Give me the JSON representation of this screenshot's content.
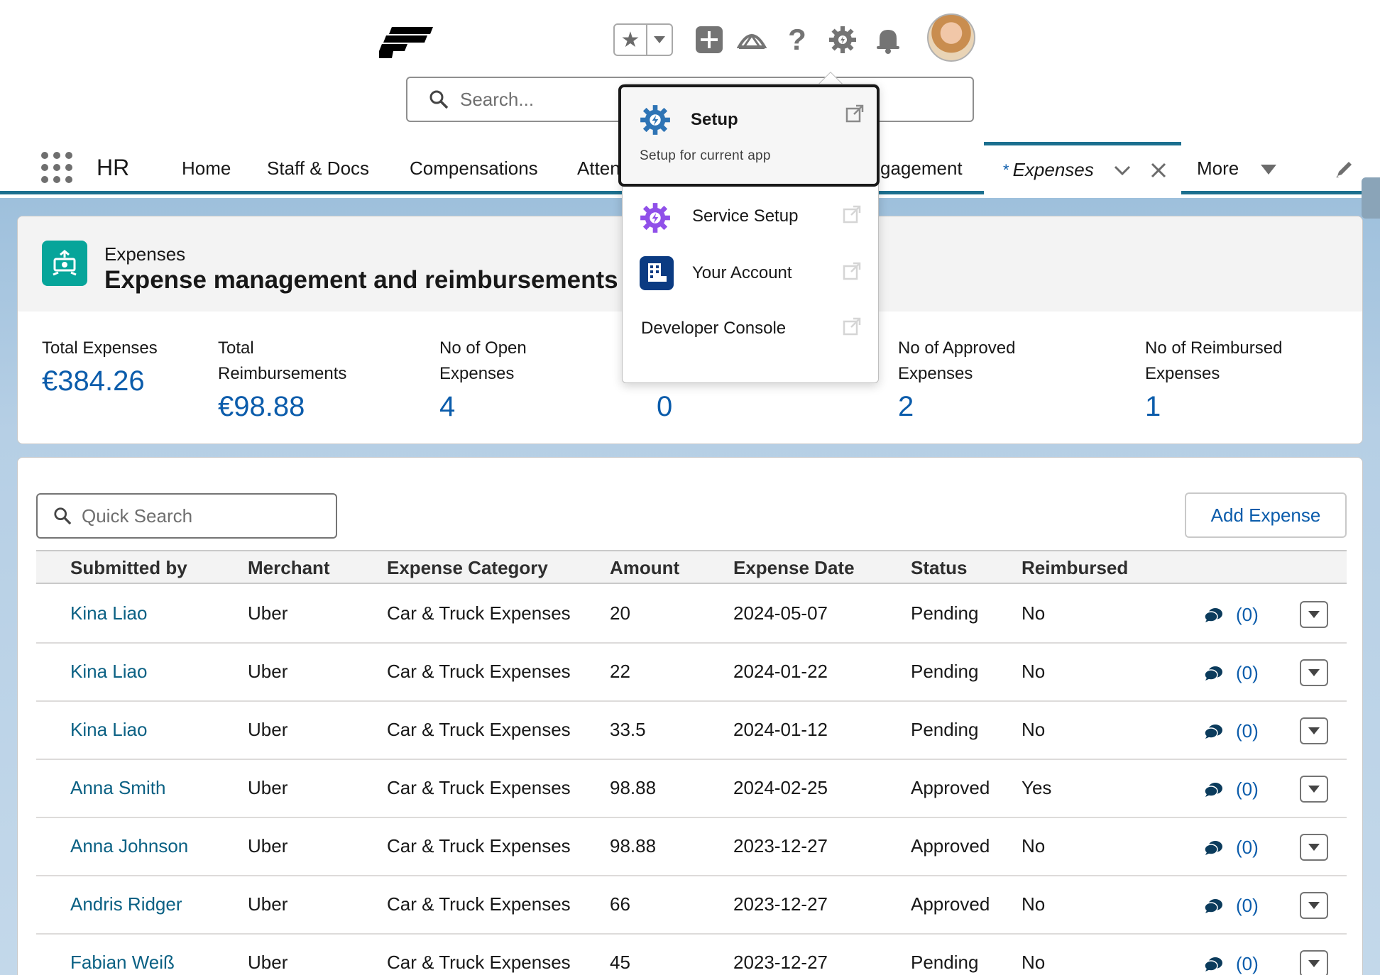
{
  "header": {
    "search_placeholder": "Search...",
    "icons": [
      "logo",
      "favorites-star-icon",
      "chevron-down-icon",
      "add-icon",
      "trailhead-icon",
      "help-icon",
      "gear-icon",
      "bell-icon",
      "avatar"
    ]
  },
  "nav": {
    "app_name": "HR",
    "items": [
      "Home",
      "Staff & Docs",
      "Compensations",
      "Atten",
      "gagement"
    ],
    "active_tab": {
      "marker": "*",
      "label": "Expenses"
    },
    "more_label": "More"
  },
  "setup_menu": {
    "setup": {
      "title": "Setup",
      "subtitle": "Setup for current app"
    },
    "service_setup": "Service Setup",
    "your_account": "Your Account",
    "developer_console": "Developer Console"
  },
  "highlights": {
    "object_label": "Expenses",
    "title": "Expense management and reimbursements",
    "metrics": [
      {
        "label": "Total Expenses",
        "value": "€384.26"
      },
      {
        "label": "Total Reimbursements",
        "value": "€98.88"
      },
      {
        "label": "No of Open Expenses",
        "value": "4"
      },
      {
        "label": "",
        "value": "0"
      },
      {
        "label": "No of Approved Expenses",
        "value": "2"
      },
      {
        "label": "No of Reimbursed Expenses",
        "value": "1"
      }
    ]
  },
  "list": {
    "quick_search_placeholder": "Quick Search",
    "add_button": "Add Expense",
    "columns": [
      "Submitted by",
      "Merchant",
      "Expense Category",
      "Amount",
      "Expense Date",
      "Status",
      "Reimbursed"
    ],
    "rows": [
      {
        "submitted_by": "Kina Liao",
        "merchant": "Uber",
        "category": "Car & Truck Expenses",
        "amount": "20",
        "date": "2024-05-07",
        "status": "Pending",
        "reimbursed": "No",
        "comments": "(0)"
      },
      {
        "submitted_by": "Kina Liao",
        "merchant": "Uber",
        "category": "Car & Truck Expenses",
        "amount": "22",
        "date": "2024-01-22",
        "status": "Pending",
        "reimbursed": "No",
        "comments": "(0)"
      },
      {
        "submitted_by": "Kina Liao",
        "merchant": "Uber",
        "category": "Car & Truck Expenses",
        "amount": "33.5",
        "date": "2024-01-12",
        "status": "Pending",
        "reimbursed": "No",
        "comments": "(0)"
      },
      {
        "submitted_by": "Anna Smith",
        "merchant": "Uber",
        "category": "Car & Truck Expenses",
        "amount": "98.88",
        "date": "2024-02-25",
        "status": "Approved",
        "reimbursed": "Yes",
        "comments": "(0)"
      },
      {
        "submitted_by": "Anna Johnson",
        "merchant": "Uber",
        "category": "Car & Truck Expenses",
        "amount": "98.88",
        "date": "2023-12-27",
        "status": "Approved",
        "reimbursed": "No",
        "comments": "(0)"
      },
      {
        "submitted_by": "Andris Ridger",
        "merchant": "Uber",
        "category": "Car & Truck Expenses",
        "amount": "66",
        "date": "2023-12-27",
        "status": "Approved",
        "reimbursed": "No",
        "comments": "(0)"
      },
      {
        "submitted_by": "Fabian Weiß",
        "merchant": "Uber",
        "category": "Car & Truck Expenses",
        "amount": "45",
        "date": "2023-12-27",
        "status": "Pending",
        "reimbursed": "No",
        "comments": "(0)"
      }
    ]
  },
  "colors": {
    "brand_link": "#0b5cab",
    "name_link": "#0b6184",
    "nav_accent": "#1b6f8f",
    "object_icon": "#06a59a",
    "service_setup_icon": "#9050e9",
    "account_icon": "#0b3b82"
  }
}
